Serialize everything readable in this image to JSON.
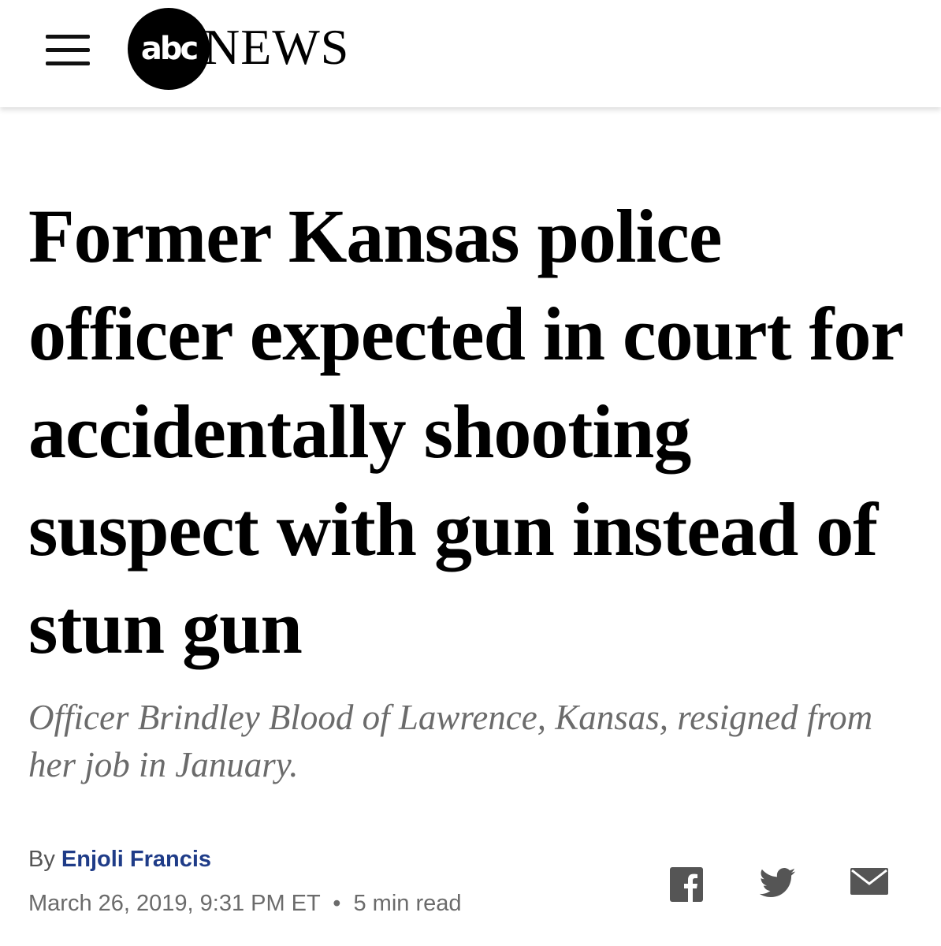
{
  "header": {
    "menu_icon": "hamburger-menu-icon",
    "logo_mark": "abc",
    "logo_word": "NEWS"
  },
  "article": {
    "headline": "Former Kansas police officer expected in court for accidentally shooting suspect with gun instead of stun gun",
    "subheadline": "Officer Brindley Blood of Lawrence, Kansas, resigned from her job in January.",
    "byline_prefix": "By",
    "author": "Enjoli Francis",
    "date": "March 26, 2019, 9:31 PM ET",
    "separator": "•",
    "read_time": "5 min read"
  },
  "share": {
    "facebook_icon": "facebook-icon",
    "twitter_icon": "twitter-icon",
    "email_icon": "email-icon"
  },
  "colors": {
    "author_link": "#1f3c88",
    "subheadline": "#6b6b6b",
    "share_icons": "#555555"
  }
}
